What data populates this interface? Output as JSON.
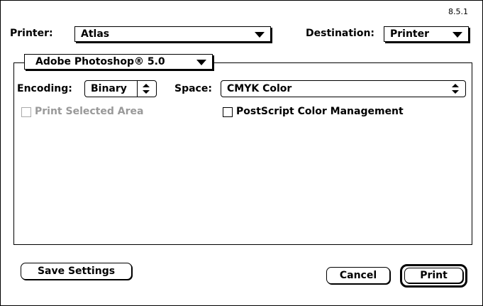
{
  "version": "8.5.1",
  "printer": {
    "label": "Printer:",
    "value": "Atlas"
  },
  "destination": {
    "label": "Destination:",
    "value": "Printer"
  },
  "section": {
    "value": "Adobe Photoshop® 5.0"
  },
  "encoding": {
    "label": "Encoding:",
    "value": "Binary"
  },
  "space": {
    "label": "Space:",
    "value": "CMYK Color"
  },
  "options": {
    "print_selected_area": "Print Selected Area",
    "postscript_color_management": "PostScript Color Management"
  },
  "buttons": {
    "save_settings": "Save Settings",
    "cancel": "Cancel",
    "print": "Print"
  },
  "icons": {
    "dropdown": "triangle-down-icon",
    "stepper": "up-down-arrows-icon"
  }
}
